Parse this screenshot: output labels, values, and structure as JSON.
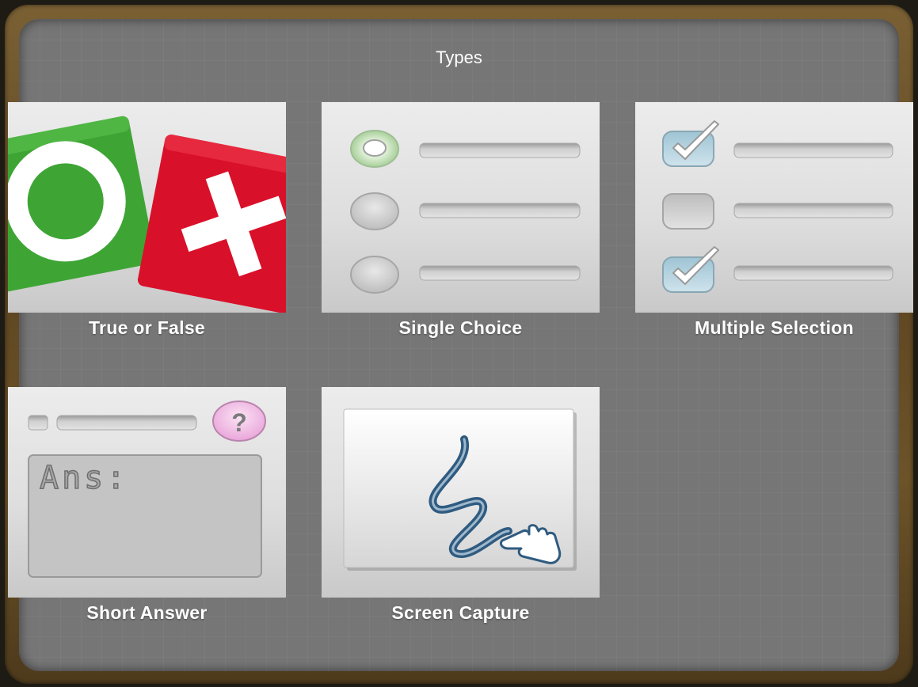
{
  "header": {
    "title": "Types"
  },
  "types": [
    {
      "label": "True or False",
      "icon": "true-false-icon"
    },
    {
      "label": "Single Choice",
      "icon": "radio-list-icon"
    },
    {
      "label": "Multiple Selection",
      "icon": "checkbox-list-icon"
    },
    {
      "label": "Short Answer",
      "icon": "short-answer-icon",
      "answer_prefix": "Ans:",
      "help_symbol": "?"
    },
    {
      "label": "Screen Capture",
      "icon": "hand-drawing-icon"
    }
  ],
  "colors": {
    "board": "#767676",
    "frame": "#6b5129",
    "true_green": "#3ea535",
    "false_red": "#d9102a",
    "check_blue": "#b8d4e0",
    "help_pink": "#e9a6da",
    "stroke_blue": "#2f5b80"
  }
}
